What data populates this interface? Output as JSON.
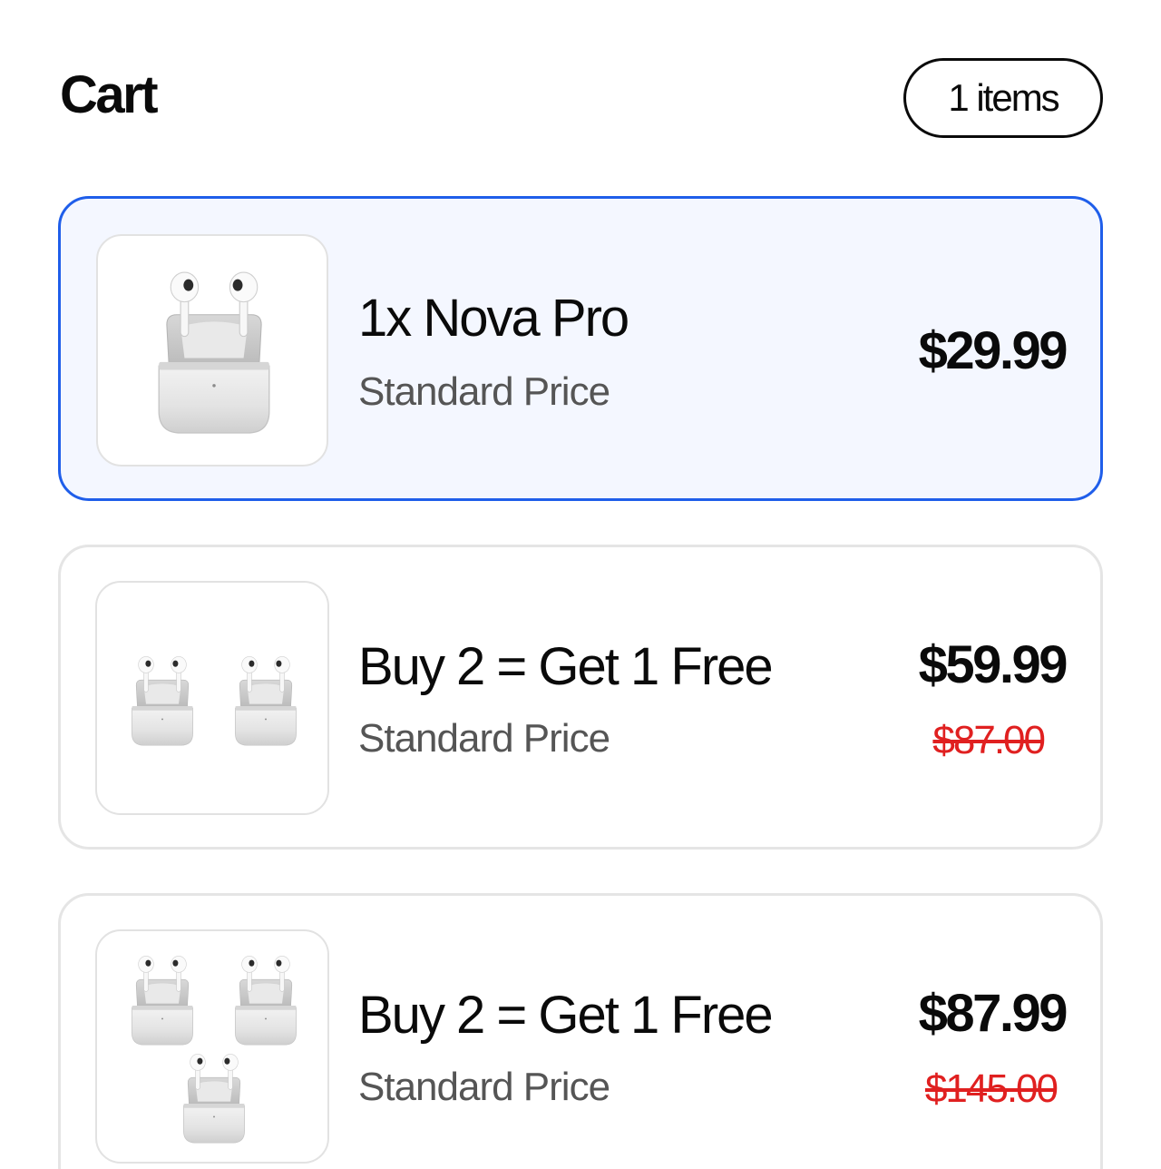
{
  "header": {
    "title": "Cart",
    "item_count_label": "1 items"
  },
  "offers": [
    {
      "name": "1x Nova Pro",
      "price_type": "Standard Price",
      "price": "$29.99",
      "original_price": "",
      "selected": true,
      "image_icon": "earbuds-case-icon"
    },
    {
      "name": "Buy 2 = Get 1 Free",
      "price_type": "Standard Price",
      "price": "$59.99",
      "original_price": "$87.00",
      "selected": false,
      "image_icon": "earbuds-case-icon"
    },
    {
      "name": "Buy 2 = Get 1 Free",
      "price_type": "Standard Price",
      "price": "$87.99",
      "original_price": "$145.00",
      "selected": false,
      "image_icon": "earbuds-case-icon"
    }
  ],
  "colors": {
    "selected_border": "#1f5eea",
    "selected_background": "#f4f7ff",
    "card_border": "#e5e5e5",
    "original_price": "#e02020"
  }
}
